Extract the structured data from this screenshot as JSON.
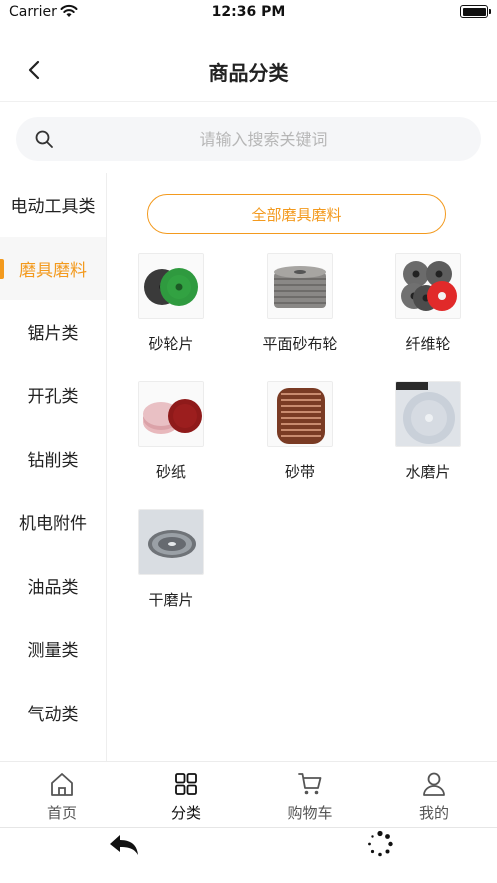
{
  "status_bar": {
    "carrier": "Carrier",
    "time": "12:36 PM"
  },
  "nav": {
    "title": "商品分类"
  },
  "search": {
    "placeholder": "请输入搜索关键词"
  },
  "sidebar": {
    "items": [
      {
        "label": "电动工具类",
        "active": false
      },
      {
        "label": "磨具磨料",
        "active": true
      },
      {
        "label": "锯片类",
        "active": false
      },
      {
        "label": "开孔类",
        "active": false
      },
      {
        "label": "钻削类",
        "active": false
      },
      {
        "label": "机电附件",
        "active": false
      },
      {
        "label": "油品类",
        "active": false
      },
      {
        "label": "测量类",
        "active": false
      },
      {
        "label": "气动类",
        "active": false
      }
    ]
  },
  "main": {
    "all_label": "全部磨具磨料",
    "products": [
      {
        "label": "砂轮片",
        "image": "grinding-disc-image"
      },
      {
        "label": "平面砂布轮",
        "image": "flap-disc-image"
      },
      {
        "label": "纤维轮",
        "image": "fiber-wheel-image"
      },
      {
        "label": "砂纸",
        "image": "sandpaper-image"
      },
      {
        "label": "砂带",
        "image": "sanding-belt-image"
      },
      {
        "label": "水磨片",
        "image": "wet-polishing-pad-image"
      },
      {
        "label": "干磨片",
        "image": "dry-polishing-pad-image"
      }
    ]
  },
  "tab_bar": {
    "tabs": [
      {
        "label": "首页",
        "icon": "home-icon",
        "active": false
      },
      {
        "label": "分类",
        "icon": "category-grid-icon",
        "active": true
      },
      {
        "label": "购物车",
        "icon": "cart-icon",
        "active": false
      },
      {
        "label": "我的",
        "icon": "user-icon",
        "active": false
      }
    ]
  },
  "colors": {
    "accent": "#f39a1e",
    "active_sidebar_bg": "#f7f7f7",
    "search_bg": "#f5f6f8"
  }
}
